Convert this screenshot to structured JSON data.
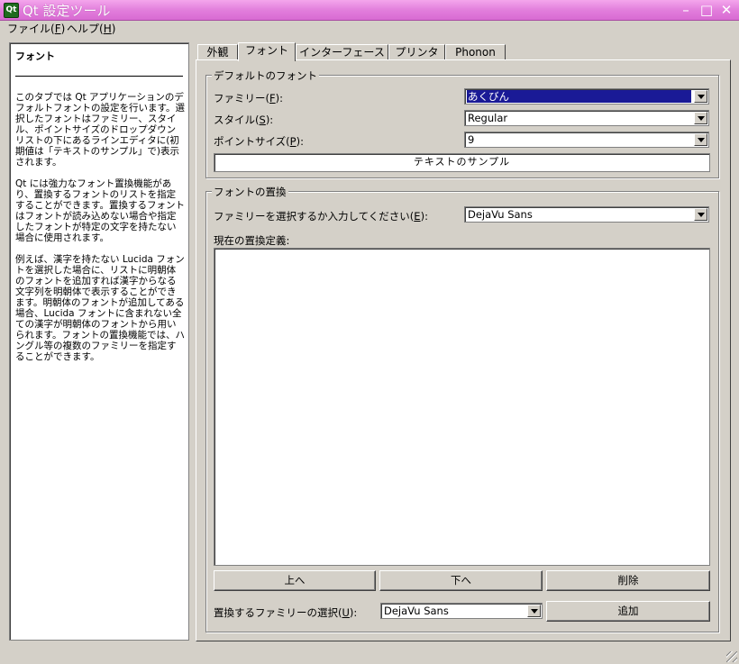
{
  "window": {
    "icon_label": "Qt",
    "title": "Qt 設定ツール",
    "minimize": "–",
    "maximize": "□",
    "close": "✕"
  },
  "menubar": {
    "file_text": "ファイル(",
    "file_key": "F",
    "file_end": ")",
    "help_text": "ヘルプ(",
    "help_key": "H",
    "help_end": ")"
  },
  "help_panel": {
    "title": "フォント",
    "paragraphs": [
      "このタブでは Qt アプリケーションのデフォルトフォントの設定を行います。選択したフォントはファミリー、スタイル、ポイントサイズのドロップダウンリストの下にあるラインエディタに(初期値は「テキストのサンプル」で)表示されます。",
      "Qt には強力なフォント置換機能があり、置換するフォントのリストを指定することができます。置換するフォントはフォントが読み込めない場合や指定したフォントが特定の文字を持たない場合に使用されます。",
      "例えば、漢字を持たない Lucida フォントを選択した場合に、リストに明朝体のフォントを追加すれば漢字からなる文字列を明朝体で表示することができます。明朝体のフォントが追加してある場合、Lucida フォントに含まれない全ての漢字が明朝体のフォントから用いられます。フォントの置換機能では、ハングル等の複数のファミリーを指定することができます。"
    ]
  },
  "tabs": [
    "外観",
    "フォント",
    "インターフェース",
    "プリンタ",
    "Phonon"
  ],
  "default_font": {
    "group_title": "デフォルトのフォント",
    "family_label": "ファミリー(",
    "family_key": "F",
    "family_value": "あくびん",
    "style_label": "スタイル(",
    "style_key": "S",
    "style_value": "Regular",
    "size_label": "ポイントサイズ(",
    "size_key": "P",
    "size_value": "9",
    "sample_text": "テキストのサンプル"
  },
  "substitution": {
    "group_title": "フォントの置換",
    "select_label": "ファミリーを選択するか入力してください(",
    "select_key": "E",
    "select_value": "DejaVu Sans",
    "current_label": "現在の置換定義:",
    "list_items": [],
    "up_button": "上へ",
    "down_button": "下へ",
    "delete_button": "削除",
    "choose_label": "置換するファミリーの選択(",
    "choose_key": "U",
    "choose_value": "DejaVu Sans",
    "add_button": "追加",
    "label_end": "):"
  },
  "colors": {
    "titlebar": "#e27fdc",
    "window_bg": "#d4d0c8",
    "selection": "#1a1a96"
  }
}
